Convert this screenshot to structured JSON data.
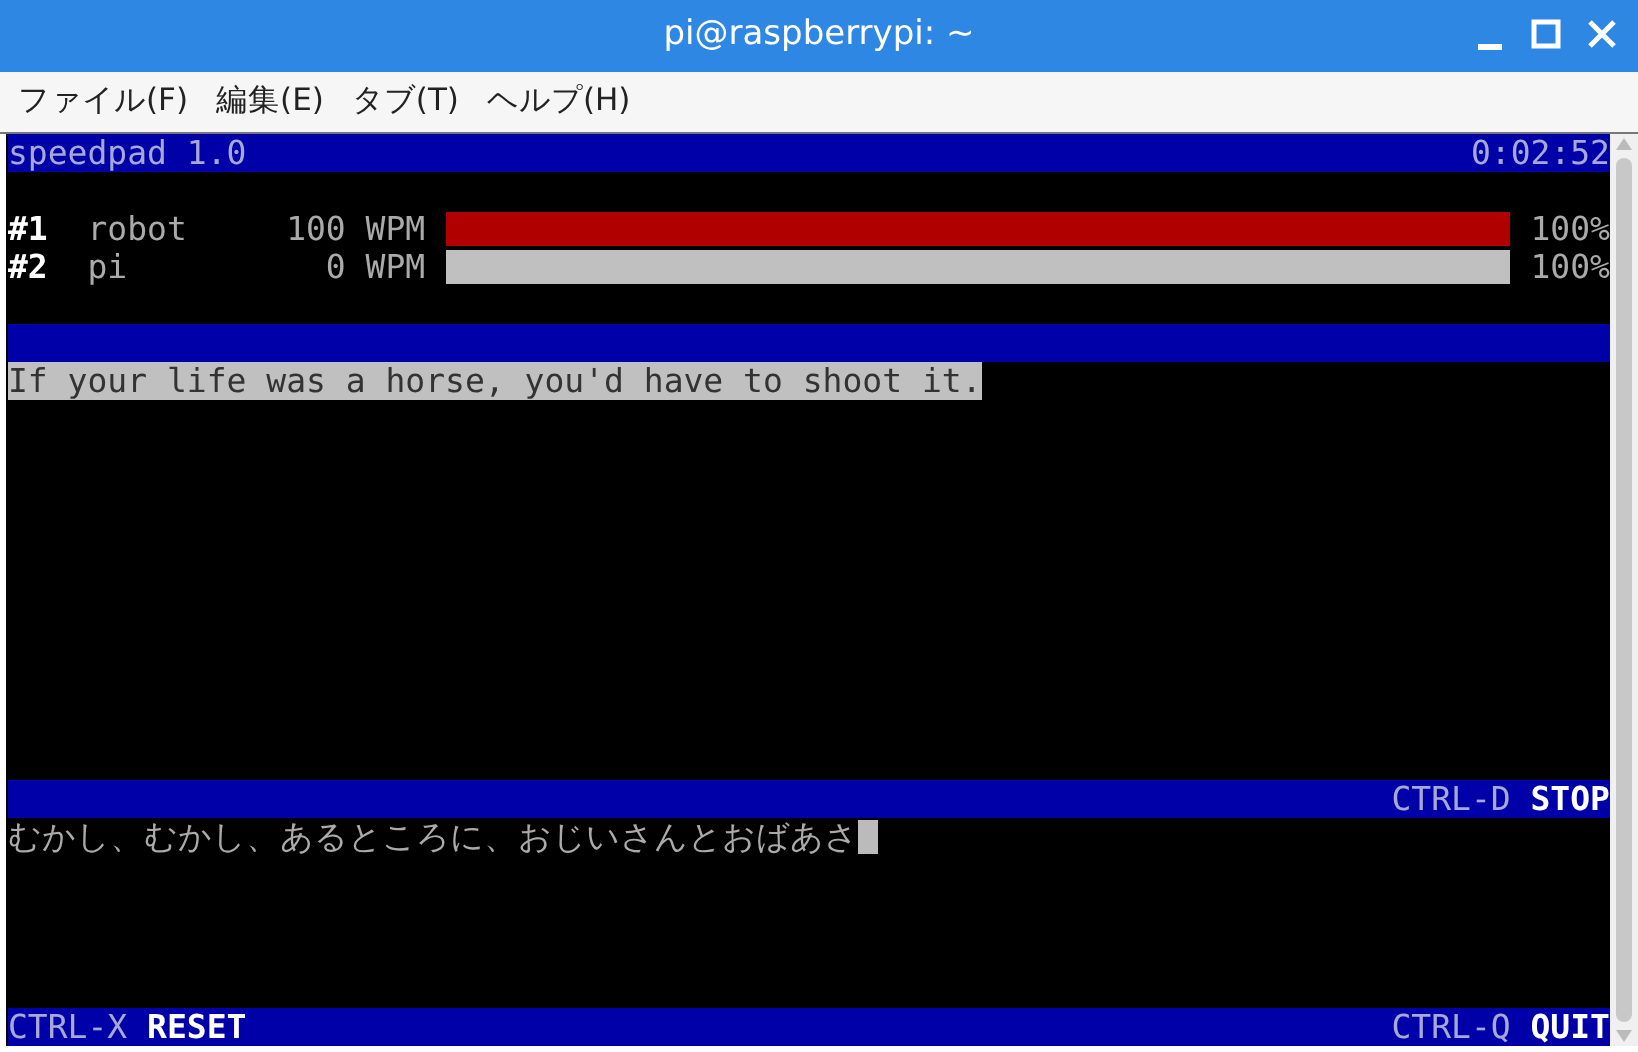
{
  "window": {
    "title": "pi@raspberrypi: ~"
  },
  "menu": [
    "ファイル(F)",
    "編集(E)",
    "タブ(T)",
    "ヘルプ(H)"
  ],
  "header": {
    "app": "speedpad 1.0",
    "timer": "0:02:52"
  },
  "players": [
    {
      "rank": "#1",
      "name": "robot",
      "wpm": "100 WPM",
      "level": 1,
      "color": "#b00000",
      "percent": "100%"
    },
    {
      "rank": "#2",
      "name": "pi",
      "wpm": "0 WPM",
      "level": 1,
      "color": "#c0c0c0",
      "percent": "100%"
    }
  ],
  "prompt": "If your life was a horse, you'd have to shoot it.",
  "input_bar": {
    "key": "CTRL-D",
    "action": "STOP"
  },
  "input": {
    "value": "むかし、むかし、あるところに、おじいさんとおばあさ"
  },
  "footer": [
    {
      "key": "CTRL-X",
      "action": "RESET"
    },
    {
      "key": "CTRL-Q",
      "action": "QUIT"
    }
  ]
}
